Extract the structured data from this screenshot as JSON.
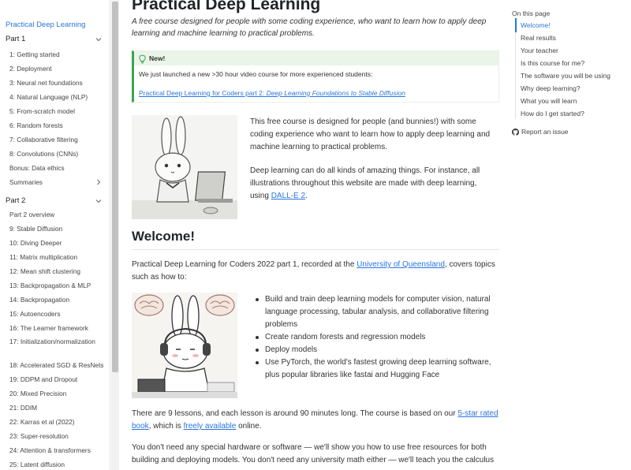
{
  "sidebar": {
    "title": "Practical Deep Learning",
    "part1": {
      "label": "Part 1",
      "items": [
        "1: Getting started",
        "2: Deployment",
        "3: Neural net foundations",
        "4: Natural Language (NLP)",
        "5: From-scratch model",
        "6: Random forests",
        "7: Collaborative filtering",
        "8: Convolutions (CNNs)",
        "Bonus: Data ethics",
        "Summaries"
      ]
    },
    "part2": {
      "label": "Part 2",
      "items": [
        "Part 2 overview",
        "9: Stable Diffusion",
        "10: Diving Deeper",
        "11: Matrix multiplication",
        "12: Mean shift clustering",
        "13: Backpropagation & MLP",
        "14: Backpropagation",
        "15: Autoencoders",
        "16: The Learner framework",
        "17: Initialization/normalization",
        "18: Accelerated SGD & ResNets",
        "19: DDPM and Dropout",
        "20: Mixed Precision",
        "21: DDIM",
        "22: Karras et al (2022)",
        "23: Super-resolution",
        "24: Attention & transformers",
        "25: Latent diffusion"
      ]
    }
  },
  "main": {
    "title": "Practical Deep Learning",
    "subtitle": "A free course designed for people with some coding experience, who want to learn how to apply deep learning and machine learning to practical problems.",
    "callout": {
      "title": "New!",
      "text": "We just launched a new >30 hour video course for more experienced students:",
      "link_prefix": "Practical Deep Learning for Coders part 2: ",
      "link_italic": "Deep Learning Foundations to Stable Diffusion"
    },
    "intro1": "This free course is designed for people (and bunnies!) with some coding experience who want to learn how to apply deep learning and machine learning to practical problems.",
    "intro2_prefix": "Deep learning can do all kinds of amazing things. For instance, all illustrations throughout this website are made with deep learning, using ",
    "intro2_link": "DALL-E 2",
    "intro2_suffix": ".",
    "welcome_heading": "Welcome!",
    "welcome_prefix": "Practical Deep Learning for Coders 2022 part 1, recorded at the ",
    "welcome_link": "University of Queensland",
    "welcome_suffix": ", covers topics such as how to:",
    "bullets": [
      "Build and train deep learning models for computer vision, natural language processing, tabular analysis, and collaborative filtering problems",
      "Create random forests and regression models",
      "Deploy models",
      "Use PyTorch, the world's fastest growing deep learning software, plus popular libraries like fastai and Hugging Face"
    ],
    "lessons_prefix": "There are 9 lessons, and each lesson is around 90 minutes long. The course is based on our ",
    "lessons_link1": "5-star rated book",
    "lessons_mid": ", which is ",
    "lessons_link2": "freely available",
    "lessons_suffix": " online.",
    "hardware": "You don't need any special hardware or software — we'll show you how to use free resources for both building and deploying models. You don't need any university math either — we'll teach you the calculus"
  },
  "toc": {
    "heading": "On this page",
    "items": [
      "Welcome!",
      "Real results",
      "Your teacher",
      "Is this course for me?",
      "The software you will be using",
      "Why deep learning?",
      "What you will learn",
      "How do I get started?"
    ],
    "report": "Report an issue"
  },
  "colors": {
    "link": "#2a76dd",
    "callout_accent": "#3aa653",
    "callout_bg": "#eaf5e7"
  }
}
